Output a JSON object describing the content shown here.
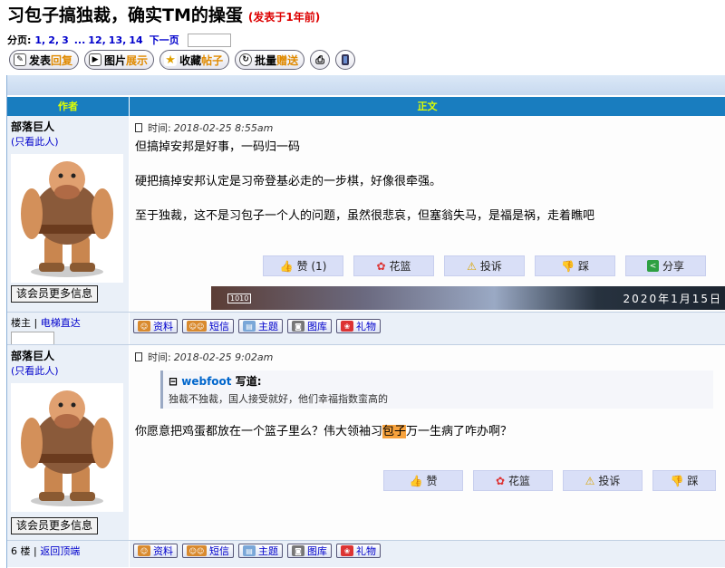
{
  "thread": {
    "title": "习包子搞独裁，确实TM的操蛋",
    "posted_ago": "(发表于1年前)"
  },
  "pager": {
    "label": "分页:",
    "pages": [
      "1,",
      "2,",
      "3"
    ],
    "ellipsis": "...",
    "last_pages": [
      "12,",
      "13,",
      "14"
    ],
    "next": "下一页"
  },
  "toolbar": {
    "reply": {
      "text": "发表",
      "highlight": "回复"
    },
    "images": {
      "text": "图片",
      "highlight": "展示"
    },
    "favorite": {
      "text": "收藏",
      "highlight": "帖子"
    },
    "batch": {
      "text": "批量",
      "highlight": "赠送"
    }
  },
  "table": {
    "col_author": "作者",
    "col_body": "正文"
  },
  "posts": [
    {
      "author": "部落巨人",
      "only_this": "(只看此人)",
      "more_info": "该会员更多信息",
      "time_label": "时间:",
      "time": "2018-02-25 8:55am",
      "paragraphs": [
        "但搞掉安邦是好事，一码归一码",
        "硬把搞掉安邦认定是习帝登基必走的一步棋，好像很牵强。",
        "至于独裁，这不是习包子一个人的问题，虽然很悲哀，但塞翁失马，是福是祸，走着瞧吧"
      ],
      "actions": {
        "like": "赞 (1)",
        "flower": "花篮",
        "report": "投诉",
        "dislike": "踩",
        "share": "分享"
      },
      "ad_text": "2020年1月15日",
      "ad_tag": "1010",
      "floor": "楼主",
      "floor_link": "电梯直达"
    },
    {
      "author": "部落巨人",
      "only_this": "(只看此人)",
      "more_info": "该会员更多信息",
      "time_label": "时间:",
      "time": "2018-02-25 9:02am",
      "quote_user": "webfoot",
      "quote_wrote": "写道:",
      "quote_text": "独裁不独裁，国人接受就好，他们幸福指数蛮高的",
      "body_before": "你愿意把鸡蛋都放在一个篮子里么？伟大领袖习",
      "body_highlight": "包子",
      "body_after": "万一生病了咋办啊？",
      "actions": {
        "like": "赞",
        "flower": "花篮",
        "report": "投诉",
        "dislike": "踩"
      },
      "floor": "6 楼",
      "floor_link": "返回顶端"
    }
  ],
  "user_buttons": {
    "profile": "资料",
    "message": "短信",
    "topics": "主题",
    "gallery": "图库",
    "gift": "礼物"
  }
}
